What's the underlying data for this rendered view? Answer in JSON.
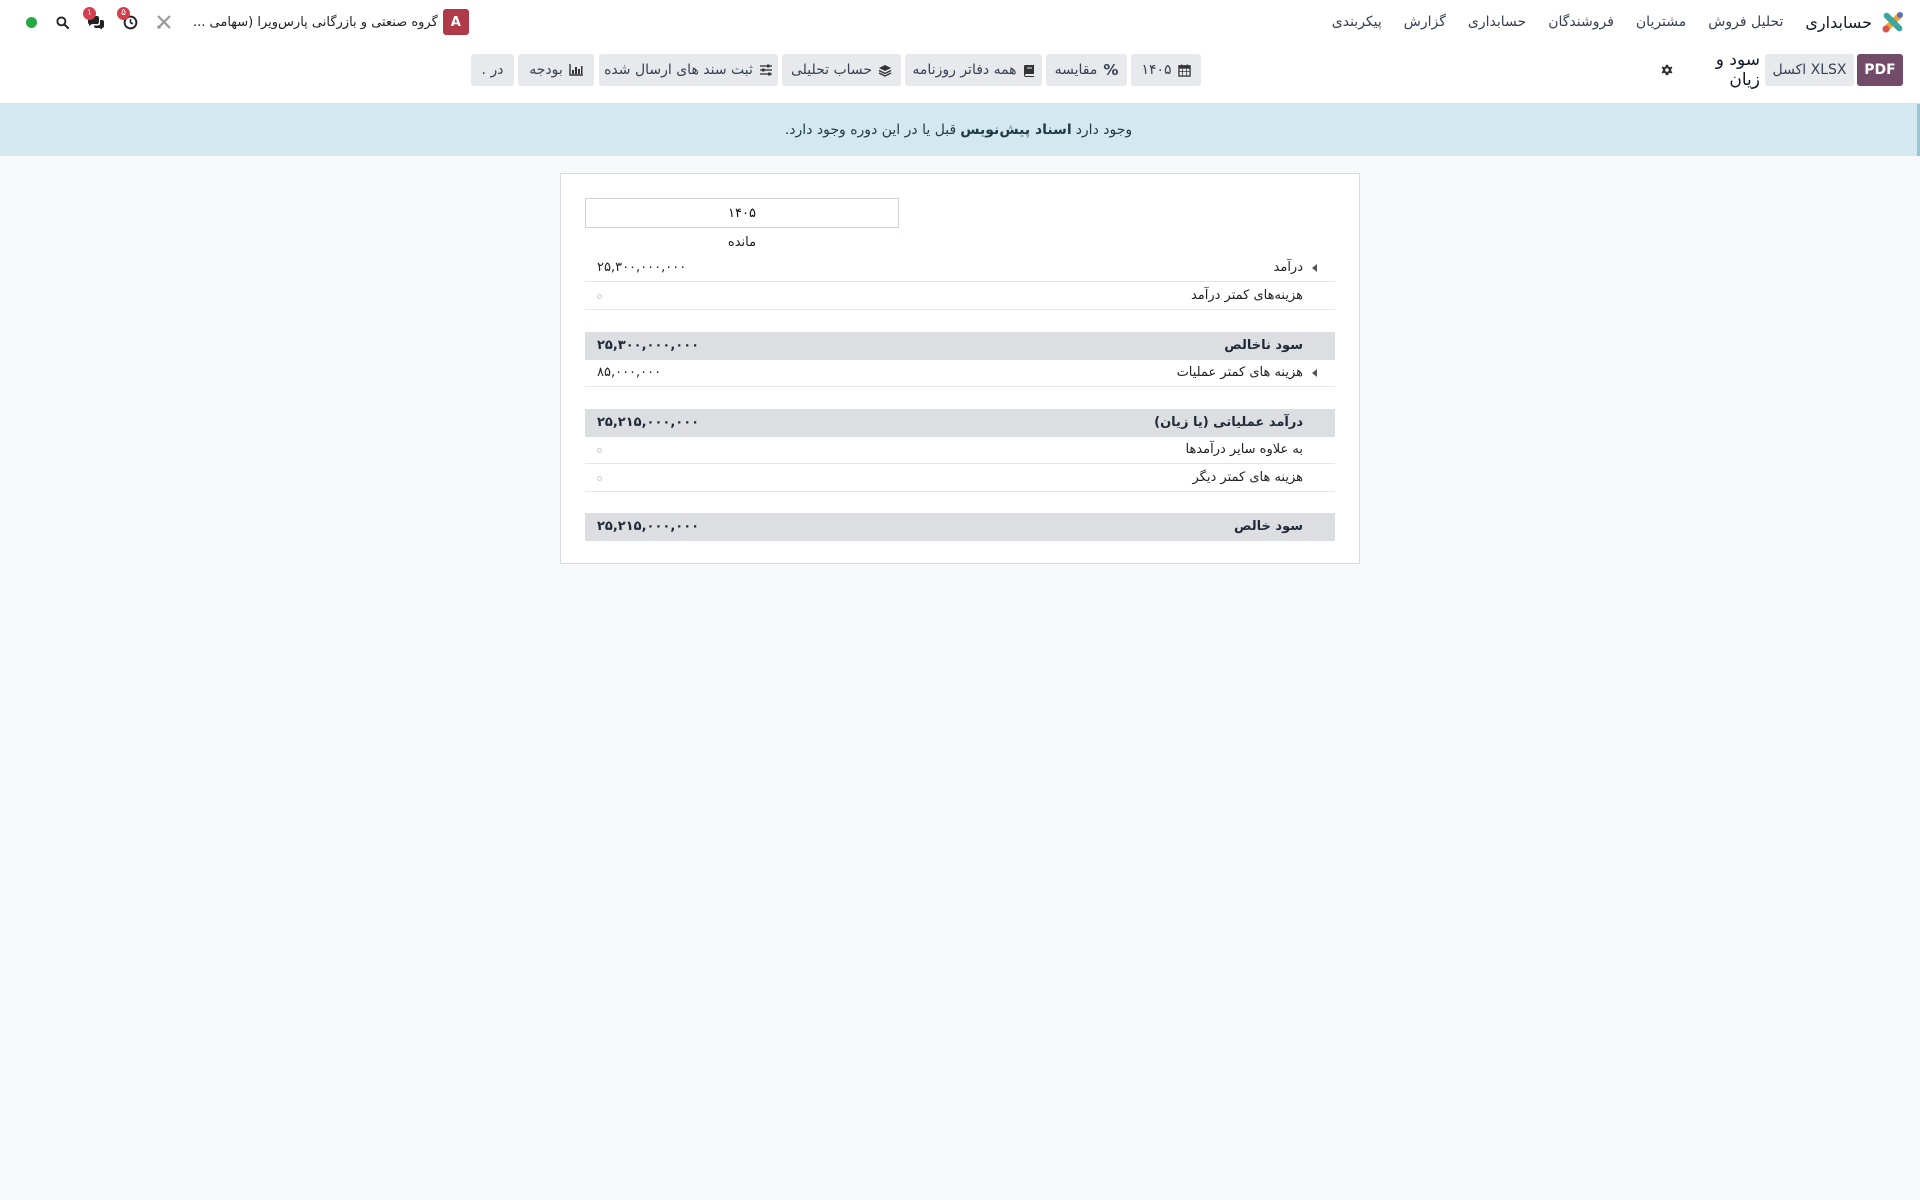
{
  "navbar": {
    "app_name": "حسابداری",
    "menu": [
      "تحلیل فروش",
      "مشتریان",
      "فروشندگان",
      "حسابداری",
      "گزارش",
      "پیکربندی"
    ],
    "company": "گروه صنعتی و بازرگانی پارس‌ویرا (سهامی ...",
    "avatar_letter": "A",
    "activity_badge": "۵",
    "chat_badge": "۱",
    "status_color": "#28a745"
  },
  "control_panel": {
    "pdf_label": "PDF",
    "xlsx_label": "XLSX اکسل",
    "page_title": "سود و زیان",
    "filters": {
      "period": "۱۴۰۵",
      "comparison": "مقایسه",
      "journals": "همه دفاتر روزنامه",
      "analytic": "حساب تحلیلی",
      "posted": "ثبت سند های ارسال شده",
      "budget": "بودجه",
      "more": "در ."
    }
  },
  "alert": {
    "prefix": "وجود دارد",
    "link": "اسناد پیش‌نویس",
    "suffix": "قبل یا در این دوره وجود دارد."
  },
  "report": {
    "column_header": "۱۴۰۵",
    "column_subheader": "مانده",
    "rows": {
      "revenue": {
        "label": "درآمد",
        "value": "۲۵,۳۰۰,۰۰۰,۰۰۰"
      },
      "cost_of_revenue": {
        "label": "هزینه‌های کمتر درآمد"
      },
      "gross_profit": {
        "label": "سود ناخالص",
        "value": "۲۵,۳۰۰,۰۰۰,۰۰۰"
      },
      "operating_expenses": {
        "label": "هزینه های کمتر عملیات",
        "value": "۸۵,۰۰۰,۰۰۰"
      },
      "operating_income": {
        "label": "درآمد عملیاتی (یا زیان)",
        "value": "۲۵,۲۱۵,۰۰۰,۰۰۰"
      },
      "other_income": {
        "label": "به علاوه سایر درآمدها"
      },
      "other_expenses": {
        "label": "هزینه های کمتر دیگر"
      },
      "net_profit": {
        "label": "سود خالص",
        "value": "۲۵,۲۱۵,۰۰۰,۰۰۰"
      }
    }
  }
}
